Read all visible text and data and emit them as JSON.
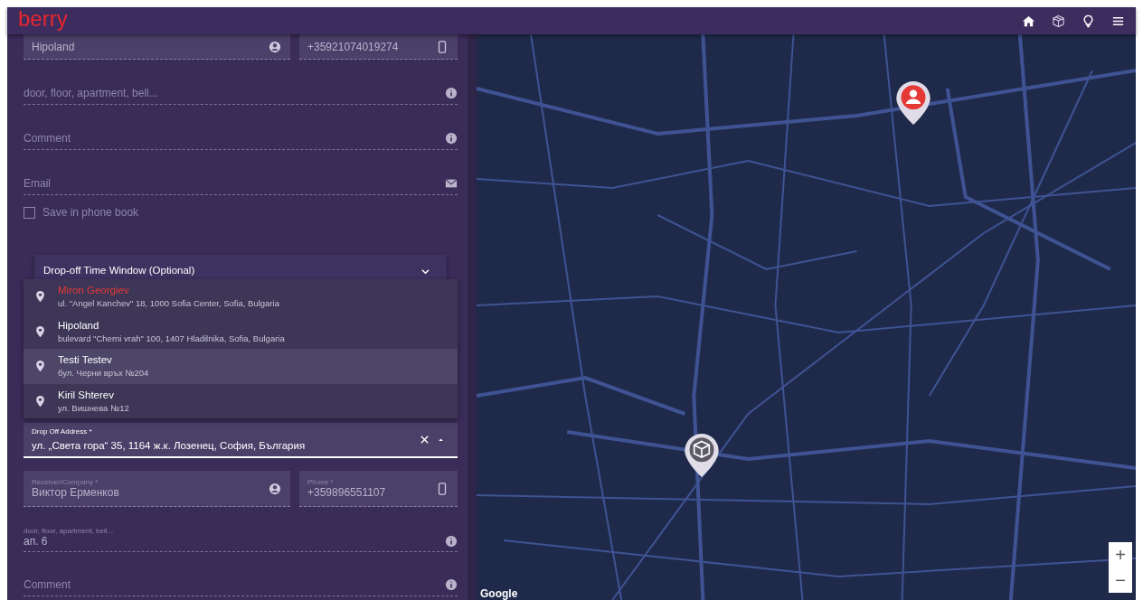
{
  "header": {
    "logo": "berry"
  },
  "sender": {
    "name": {
      "value": "Hipoland"
    },
    "phone": {
      "value": "+35921074019274"
    },
    "details": {
      "placeholder": "door, floor, apartment, bell..."
    },
    "comment": {
      "placeholder": "Comment"
    },
    "email": {
      "placeholder": "Email"
    },
    "save_in_phone_book": {
      "label": "Save in phone book",
      "checked": false
    }
  },
  "time_window": {
    "label": "Drop-off Time Window (Optional)",
    "expanded": false
  },
  "suggestions": [
    {
      "name": "Miron Georgiev",
      "address": "ul. \"Angel Kanchev\" 18, 1000 Sofia Center, Sofia, Bulgaria",
      "active": true,
      "selected": false
    },
    {
      "name": "Hipoland",
      "address": "bulevard \"Cherni vrah\" 100, 1407 Hladilnika, Sofia, Bulgaria",
      "active": false,
      "selected": false
    },
    {
      "name": "Testi Testev",
      "address": "бул. Черни връх №204",
      "active": false,
      "selected": true
    },
    {
      "name": "Kiril Shterev",
      "address": "ул. Вишнева №12",
      "active": false,
      "selected": false
    }
  ],
  "dropoff": {
    "address": {
      "label": "Drop Off Address *",
      "value": "ул. „Света гора“ 35, 1164 ж.к. Лозенец, София, България"
    },
    "receiver": {
      "label": "Receiver/Company *",
      "value": "Виктор Ерменков"
    },
    "phone": {
      "label": "Phone *",
      "value": "+359896551107"
    },
    "details": {
      "label": "door, floor, apartment, bell...",
      "value": "ап. 6"
    },
    "comment": {
      "placeholder": "Comment"
    }
  },
  "map": {
    "zoom_in": "+",
    "zoom_out": "−",
    "attribution": "Google"
  }
}
